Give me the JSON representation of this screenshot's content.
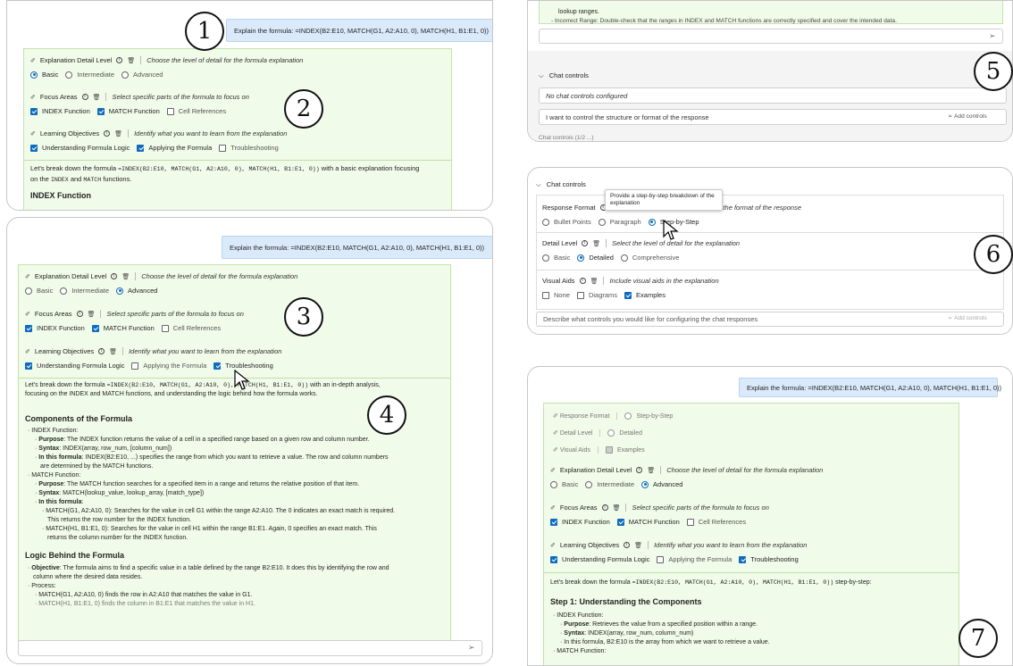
{
  "panel1": {
    "bubble": "Explain the formula: =INDEX(B2:E10, MATCH(G1, A2:A10, 0), MATCH(H1, B1:E1, 0))",
    "ctl_detail": {
      "label": "Explanation Detail Level",
      "desc": "Choose the level of detail for the formula explanation",
      "options": [
        "Basic",
        "Intermediate",
        "Advanced"
      ]
    },
    "ctl_focus": {
      "label": "Focus Areas",
      "desc": "Select specific parts of the formula to focus on",
      "options": [
        "INDEX Function",
        "MATCH Function",
        "Cell References"
      ]
    },
    "ctl_learn": {
      "label": "Learning Objectives",
      "desc": "Identify what you want to learn from the explanation",
      "options": [
        "Understanding Formula Logic",
        "Applying the Formula",
        "Troubleshooting"
      ]
    },
    "response_pre": "Let's break down the formula ",
    "response_formula": "=INDEX(B2:E10, MATCH(G1, A2:A10, 0), MATCH(H1, B1:E1, 0))",
    "response_post": " with a basic explanation focusing",
    "response_line2a": "on the ",
    "response_index": "INDEX",
    "response_and": " and ",
    "response_match": "MATCH",
    "response_line2b": " functions.",
    "heading": "INDEX Function"
  },
  "panel2": {
    "bubble": "Explain the formula: =INDEX(B2:E10, MATCH(G1, A2:A10, 0), MATCH(H1, B1:E1, 0))",
    "ctl_detail": {
      "label": "Explanation Detail Level",
      "desc": "Choose the level of detail for the formula explanation",
      "options": [
        "Basic",
        "Intermediate",
        "Advanced"
      ]
    },
    "ctl_focus": {
      "label": "Focus Areas",
      "desc": "Select specific parts of the formula to focus on",
      "options": [
        "INDEX Function",
        "MATCH Function",
        "Cell References"
      ]
    },
    "ctl_learn": {
      "label": "Learning Objectives",
      "desc": "Identify what you want to learn from the explanation",
      "options": [
        "Understanding Formula Logic",
        "Applying the Formula",
        "Troubleshooting"
      ]
    },
    "intro1a": "Let's break down the formula ",
    "intro1f": "=INDEX(B2:E10, MATCH(G1, A2:A10, 0), MATCH(H1, B1:E1, 0))",
    "intro1b": " with an in-depth analysis,",
    "intro2": "focusing on the INDEX and MATCH functions, and understanding the logic behind how the formula works.",
    "h_components": "Components of the Formula",
    "l1": "INDEX Function:",
    "l2b": "Purpose",
    "l2": ": The INDEX function returns the value of a cell in a specified range based on a given row and column number.",
    "l3b": "Syntax",
    "l3": ": INDEX(array, row_num, [column_num])",
    "l4b": "In this formula",
    "l4": ": INDEX(B2:E10, ...) specifies the range from which you want to retrieve a value. The row and column numbers",
    "l5": "are determined by the MATCH functions.",
    "l6": "MATCH Function:",
    "l7b": "Purpose",
    "l7": ": The MATCH function searches for a specified item in a range and returns the relative position of that item.",
    "l8b": "Syntax",
    "l8": ": MATCH(lookup_value, lookup_array, [match_type])",
    "l9b": "In this formula",
    "l9": ":",
    "l10": "MATCH(G1, A2:A10, 0): Searches for the value in cell G1 within the range A2:A10. The 0 indicates an exact match is required.",
    "l11": "This returns the row number for the INDEX function.",
    "l12": "MATCH(H1, B1:E1, 0): Searches for the value in cell H1 within the range B1:E1. Again, 0 specifies an exact match. This",
    "l13": "returns the column number for the INDEX function.",
    "h_logic": "Logic Behind the Formula",
    "l14b": "Objective",
    "l14": ": The formula aims to find a specific value in a table defined by the range B2:E10. It does this by identifying the row and",
    "l15": "column where the desired data resides.",
    "l16": "Process:",
    "l17": "MATCH(G1, A2:A10, 0) finds the row in A2:A10 that matches the value in G1.",
    "l18": "MATCH(H1, B1:E1, 0) finds the column in B1:E1 that matches the value in H1."
  },
  "panel5": {
    "top1": "lookup ranges.",
    "top2": "- Incorrect Range: Double-check that the ranges in INDEX and MATCH functions are correctly specified and cover the intended data.",
    "section": "Chat controls",
    "empty": "No chat controls configured",
    "input": "I want to control the structure or format of the response",
    "add": "Add controls",
    "bottom": "Chat controls (1/2 ...)"
  },
  "panel6": {
    "section": "Chat controls",
    "tooltip": "Provide a step-by-step breakdown of the explanation",
    "ctl_format": {
      "label": "Response Format",
      "desc": "Choose the format of the response",
      "options": [
        "Bullet Points",
        "Paragraph",
        "Step-by-Step"
      ]
    },
    "ctl_detail": {
      "label": "Detail Level",
      "desc": "Select the level of detail for the explanation",
      "options": [
        "Basic",
        "Detailed",
        "Comprehensive"
      ]
    },
    "ctl_visual": {
      "label": "Visual Aids",
      "desc": "Include visual aids in the explanation",
      "options": [
        "None",
        "Diagrams",
        "Examples"
      ]
    },
    "input_placeholder": "Describe what controls you would like for configuring the chat responses",
    "add": "Add controls"
  },
  "panel7": {
    "bubble": "Explain the formula: =INDEX(B2:E10, MATCH(G1, A2:A10, 0), MATCH(H1, B1:E1, 0))",
    "summary": [
      {
        "label": "Response Format",
        "value": "Step-by-Step"
      },
      {
        "label": "Detail Level",
        "value": "Detailed"
      },
      {
        "label": "Visual Aids",
        "value": "Examples"
      }
    ],
    "ctl_detail": {
      "label": "Explanation Detail Level",
      "desc": "Choose the level of detail for the formula explanation",
      "options": [
        "Basic",
        "Intermediate",
        "Advanced"
      ]
    },
    "ctl_focus": {
      "label": "Focus Areas",
      "desc": "Select specific parts of the formula to focus on",
      "options": [
        "INDEX Function",
        "MATCH Function",
        "Cell References"
      ]
    },
    "ctl_learn": {
      "label": "Learning Objectives",
      "desc": "Identify what you want to learn from the explanation",
      "options": [
        "Understanding Formula Logic",
        "Applying the Formula",
        "Troubleshooting"
      ]
    },
    "intro_a": "Let's break down the formula ",
    "intro_f": "=INDEX(B2:E10, MATCH(G1, A2:A10, 0), MATCH(H1, B1:E1, 0))",
    "intro_b": " step-by-step:",
    "step1": "Step 1: Understanding the Components",
    "s1": "INDEX Function:",
    "s2b": "Purpose",
    "s2": ": Retrieves the value from a specified position within a range.",
    "s3b": "Syntax",
    "s3": ": INDEX(array, row_num, column_num)",
    "s4": "In this formula, B2:E10 is the array from which we want to retrieve a value.",
    "s5": "MATCH Function:"
  },
  "callouts": [
    "1",
    "2",
    "3",
    "4",
    "5",
    "6",
    "7"
  ]
}
